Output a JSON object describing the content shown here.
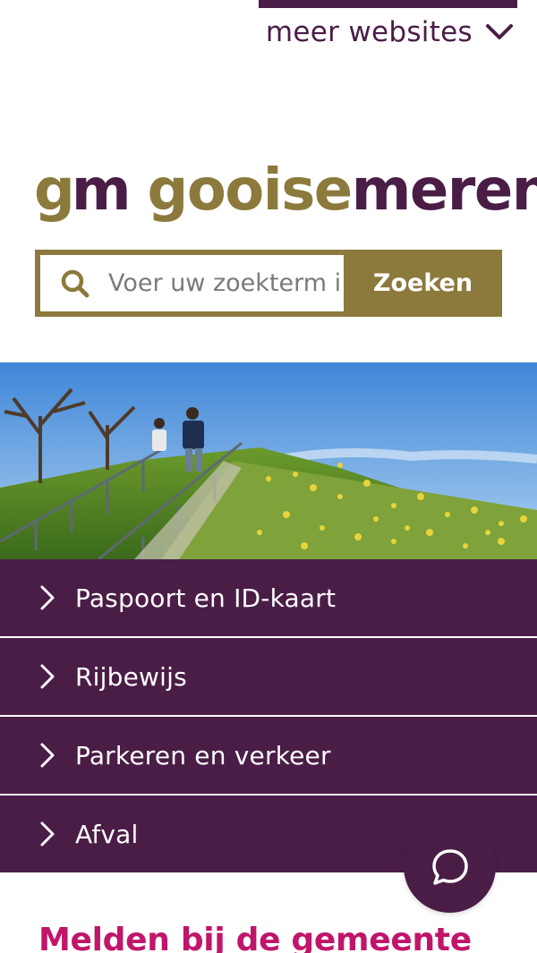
{
  "header": {
    "more_websites_label": "meer websites",
    "chevron_icon": "chevron-down-icon"
  },
  "logo": {
    "mark_g": "g",
    "mark_m": "m",
    "word_part1": "gooise",
    "word_part2": "meren",
    "colors": {
      "gold": "#8c7a3c",
      "purple": "#4a1d46"
    }
  },
  "search": {
    "placeholder": "Voer uw zoekterm in",
    "value": "",
    "button_label": "Zoeken",
    "icon": "search-icon"
  },
  "menu": {
    "items": [
      {
        "label": "Paspoort en ID-kaart",
        "icon": "chevron-right-icon"
      },
      {
        "label": "Rijbewijs",
        "icon": "chevron-right-icon"
      },
      {
        "label": "Parkeren en verkeer",
        "icon": "chevron-right-icon"
      },
      {
        "label": "Afval",
        "icon": "chevron-right-icon"
      }
    ]
  },
  "chat": {
    "icon": "chat-bubble-icon"
  },
  "section": {
    "heading": "Melden bij de gemeente"
  },
  "theme": {
    "purple": "#4a1d46",
    "gold": "#8c7a3c",
    "magenta": "#c0156b"
  }
}
